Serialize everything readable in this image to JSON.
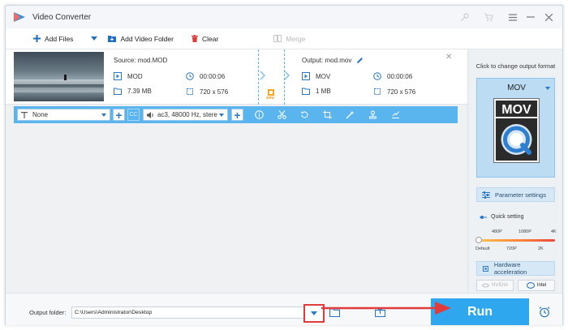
{
  "app": {
    "title": "Video Converter"
  },
  "toolbar": {
    "add_files": "Add Files",
    "add_video_folder": "Add Video Folder",
    "clear": "Clear",
    "merge": "Merge"
  },
  "task": {
    "source_label": "Source: mod.MOD",
    "output_label": "Output: mod.mov",
    "source": {
      "format": "MOD",
      "duration": "00:00:06",
      "size": "7.39 MB",
      "resolution": "720 x 576"
    },
    "output": {
      "format": "MOV",
      "duration": "00:00:06",
      "size": "1 MB",
      "resolution": "720 x 576"
    },
    "gpu_label": "GPU"
  },
  "editbar": {
    "subtitle": "None",
    "audio": "ac3, 48000 Hz, stere"
  },
  "right_panel": {
    "title": "Click to change output format",
    "format": "MOV",
    "format_icon_text": "MOV",
    "parameter_settings": "Parameter settings",
    "quick_setting": "Quick setting",
    "ticks_top": [
      "480P",
      "1080P",
      "4K"
    ],
    "ticks_bottom": [
      "Default",
      "720P",
      "2K"
    ],
    "hardware_acceleration": "Hardware acceleration",
    "nvidia": "NVIDIA",
    "intel": "Intel"
  },
  "bottom": {
    "output_folder_label": "Output folder:",
    "output_folder_value": "C:\\Users\\Administrator\\Desktop",
    "run": "Run"
  },
  "colors": {
    "accent": "#2ea7ef",
    "editbar": "#5ab5ef",
    "highlight": "#e23b3b"
  }
}
